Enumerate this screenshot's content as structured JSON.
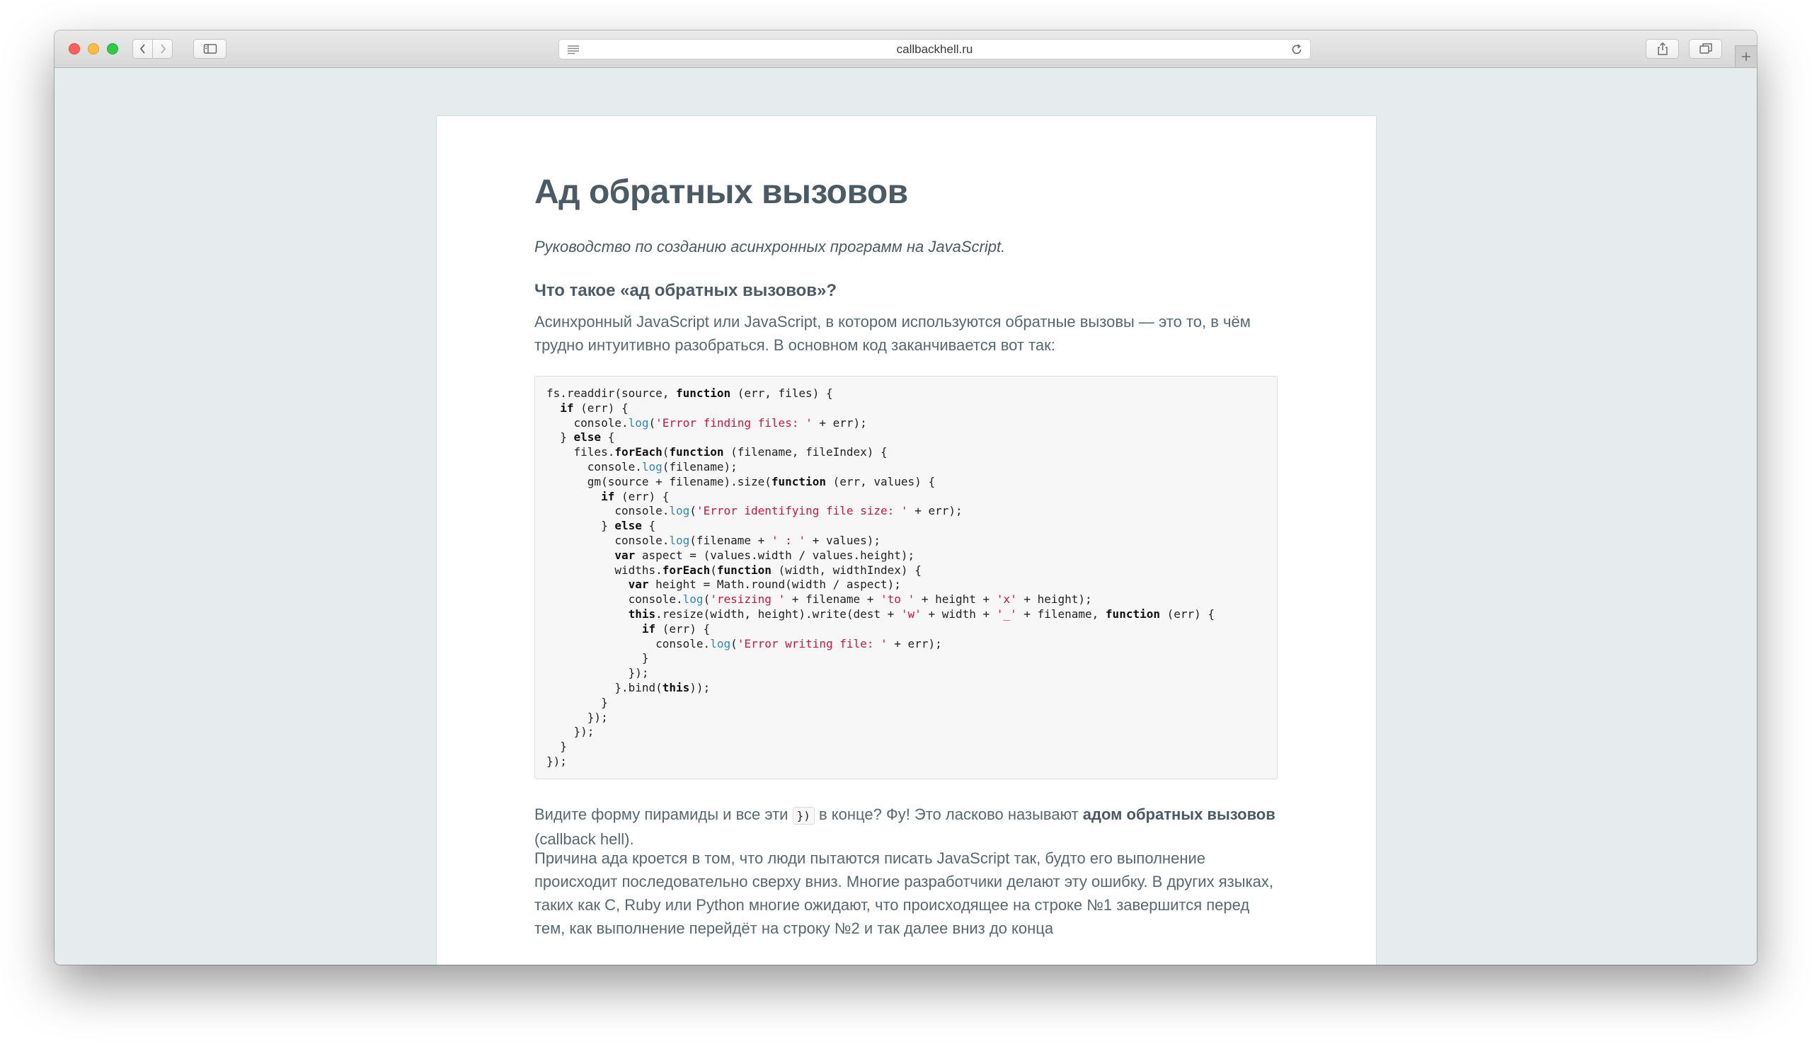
{
  "browser": {
    "url": "callbackhell.ru",
    "icons": {
      "back": "chevron-left-icon",
      "forward": "chevron-right-icon",
      "sidebar": "sidebar-icon",
      "reader": "reader-icon",
      "reload": "reload-icon",
      "share": "share-icon",
      "tabs": "tabs-overview-icon",
      "new_tab": "plus-icon"
    }
  },
  "article": {
    "title": "Ад обратных вызовов",
    "subtitle": "Руководство по созданию асинхронных программ на JavaScript.",
    "section_heading": "Что такое «ад обратных вызовов»?",
    "intro": "Асинхронный JavaScript или JavaScript, в котором используются обратные вызовы — это то, в чём трудно интуитивно разобраться. В основном код заканчивается вот так:",
    "code_lines": [
      [
        [
          "fs.readdir(source, ",
          ""
        ],
        [
          "function",
          "kw"
        ],
        [
          " (err, files) {",
          ""
        ]
      ],
      [
        [
          "  ",
          ""
        ],
        [
          "if",
          "kw"
        ],
        [
          " (err) {",
          ""
        ]
      ],
      [
        [
          "    console.",
          ""
        ],
        [
          "log",
          "fn"
        ],
        [
          "(",
          ""
        ],
        [
          "'Error finding files: '",
          "str"
        ],
        [
          " + err);",
          ""
        ]
      ],
      [
        [
          "  } ",
          ""
        ],
        [
          "else",
          "kw"
        ],
        [
          " {",
          ""
        ]
      ],
      [
        [
          "    files.",
          ""
        ],
        [
          "forEach",
          "kw"
        ],
        [
          "(",
          ""
        ],
        [
          "function",
          "kw"
        ],
        [
          " (filename, fileIndex) {",
          ""
        ]
      ],
      [
        [
          "      console.",
          ""
        ],
        [
          "log",
          "fn"
        ],
        [
          "(filename);",
          ""
        ]
      ],
      [
        [
          "      gm(source + filename).size(",
          ""
        ],
        [
          "function",
          "kw"
        ],
        [
          " (err, values) {",
          ""
        ]
      ],
      [
        [
          "        ",
          ""
        ],
        [
          "if",
          "kw"
        ],
        [
          " (err) {",
          ""
        ]
      ],
      [
        [
          "          console.",
          ""
        ],
        [
          "log",
          "fn"
        ],
        [
          "(",
          ""
        ],
        [
          "'Error identifying file size: '",
          "str"
        ],
        [
          " + err);",
          ""
        ]
      ],
      [
        [
          "        } ",
          ""
        ],
        [
          "else",
          "kw"
        ],
        [
          " {",
          ""
        ]
      ],
      [
        [
          "          console.",
          ""
        ],
        [
          "log",
          "fn"
        ],
        [
          "(filename + ",
          ""
        ],
        [
          "' : '",
          "str"
        ],
        [
          " + values);",
          ""
        ]
      ],
      [
        [
          "          ",
          ""
        ],
        [
          "var",
          "kw"
        ],
        [
          " aspect = (values.width / values.height);",
          ""
        ]
      ],
      [
        [
          "          widths.",
          ""
        ],
        [
          "forEach",
          "kw"
        ],
        [
          "(",
          ""
        ],
        [
          "function",
          "kw"
        ],
        [
          " (width, widthIndex) {",
          ""
        ]
      ],
      [
        [
          "            ",
          ""
        ],
        [
          "var",
          "kw"
        ],
        [
          " height = Math.round(width / aspect);",
          ""
        ]
      ],
      [
        [
          "            console.",
          ""
        ],
        [
          "log",
          "fn"
        ],
        [
          "(",
          ""
        ],
        [
          "'resizing '",
          "str"
        ],
        [
          " + filename + ",
          ""
        ],
        [
          "'to '",
          "str"
        ],
        [
          " + height + ",
          ""
        ],
        [
          "'x'",
          "str"
        ],
        [
          " + height);",
          ""
        ]
      ],
      [
        [
          "            ",
          ""
        ],
        [
          "this",
          "kw"
        ],
        [
          ".resize(width, height).write(dest + ",
          ""
        ],
        [
          "'w'",
          "str"
        ],
        [
          " + width + ",
          ""
        ],
        [
          "'_'",
          "str"
        ],
        [
          " + filename, ",
          ""
        ],
        [
          "function",
          "kw"
        ],
        [
          " (err) {",
          ""
        ]
      ],
      [
        [
          "              ",
          ""
        ],
        [
          "if",
          "kw"
        ],
        [
          " (err) {",
          ""
        ]
      ],
      [
        [
          "                console.",
          ""
        ],
        [
          "log",
          "fn"
        ],
        [
          "(",
          ""
        ],
        [
          "'Error writing file: '",
          "str"
        ],
        [
          " + err);",
          ""
        ]
      ],
      [
        [
          "              }",
          ""
        ]
      ],
      [
        [
          "            });",
          ""
        ]
      ],
      [
        [
          "          }.bind(",
          ""
        ],
        [
          "this",
          "kw"
        ],
        [
          "));",
          ""
        ]
      ],
      [
        [
          "        }",
          ""
        ]
      ],
      [
        [
          "      });",
          ""
        ]
      ],
      [
        [
          "    });",
          ""
        ]
      ],
      [
        [
          "  }",
          ""
        ]
      ],
      [
        [
          "});",
          ""
        ]
      ]
    ],
    "p2": {
      "before": "Видите форму пирамиды и все эти ",
      "code": "})",
      "middle": " в конце? Фу! Это ласково называют ",
      "strong": "адом обратных вызовов",
      "after": " (callback hell)."
    },
    "p3": "Причина ада кроется в том, что люди пытаются писать JavaScript так, будто его выполнение происходит последовательно сверху вниз. Многие разработчики делают эту ошибку. В других языках, таких как C, Ruby или Python многие ожидают, что происходящее на строке №1 завершится перед тем, как выполнение перейдёт на строку №2 и так далее вниз до конца"
  }
}
